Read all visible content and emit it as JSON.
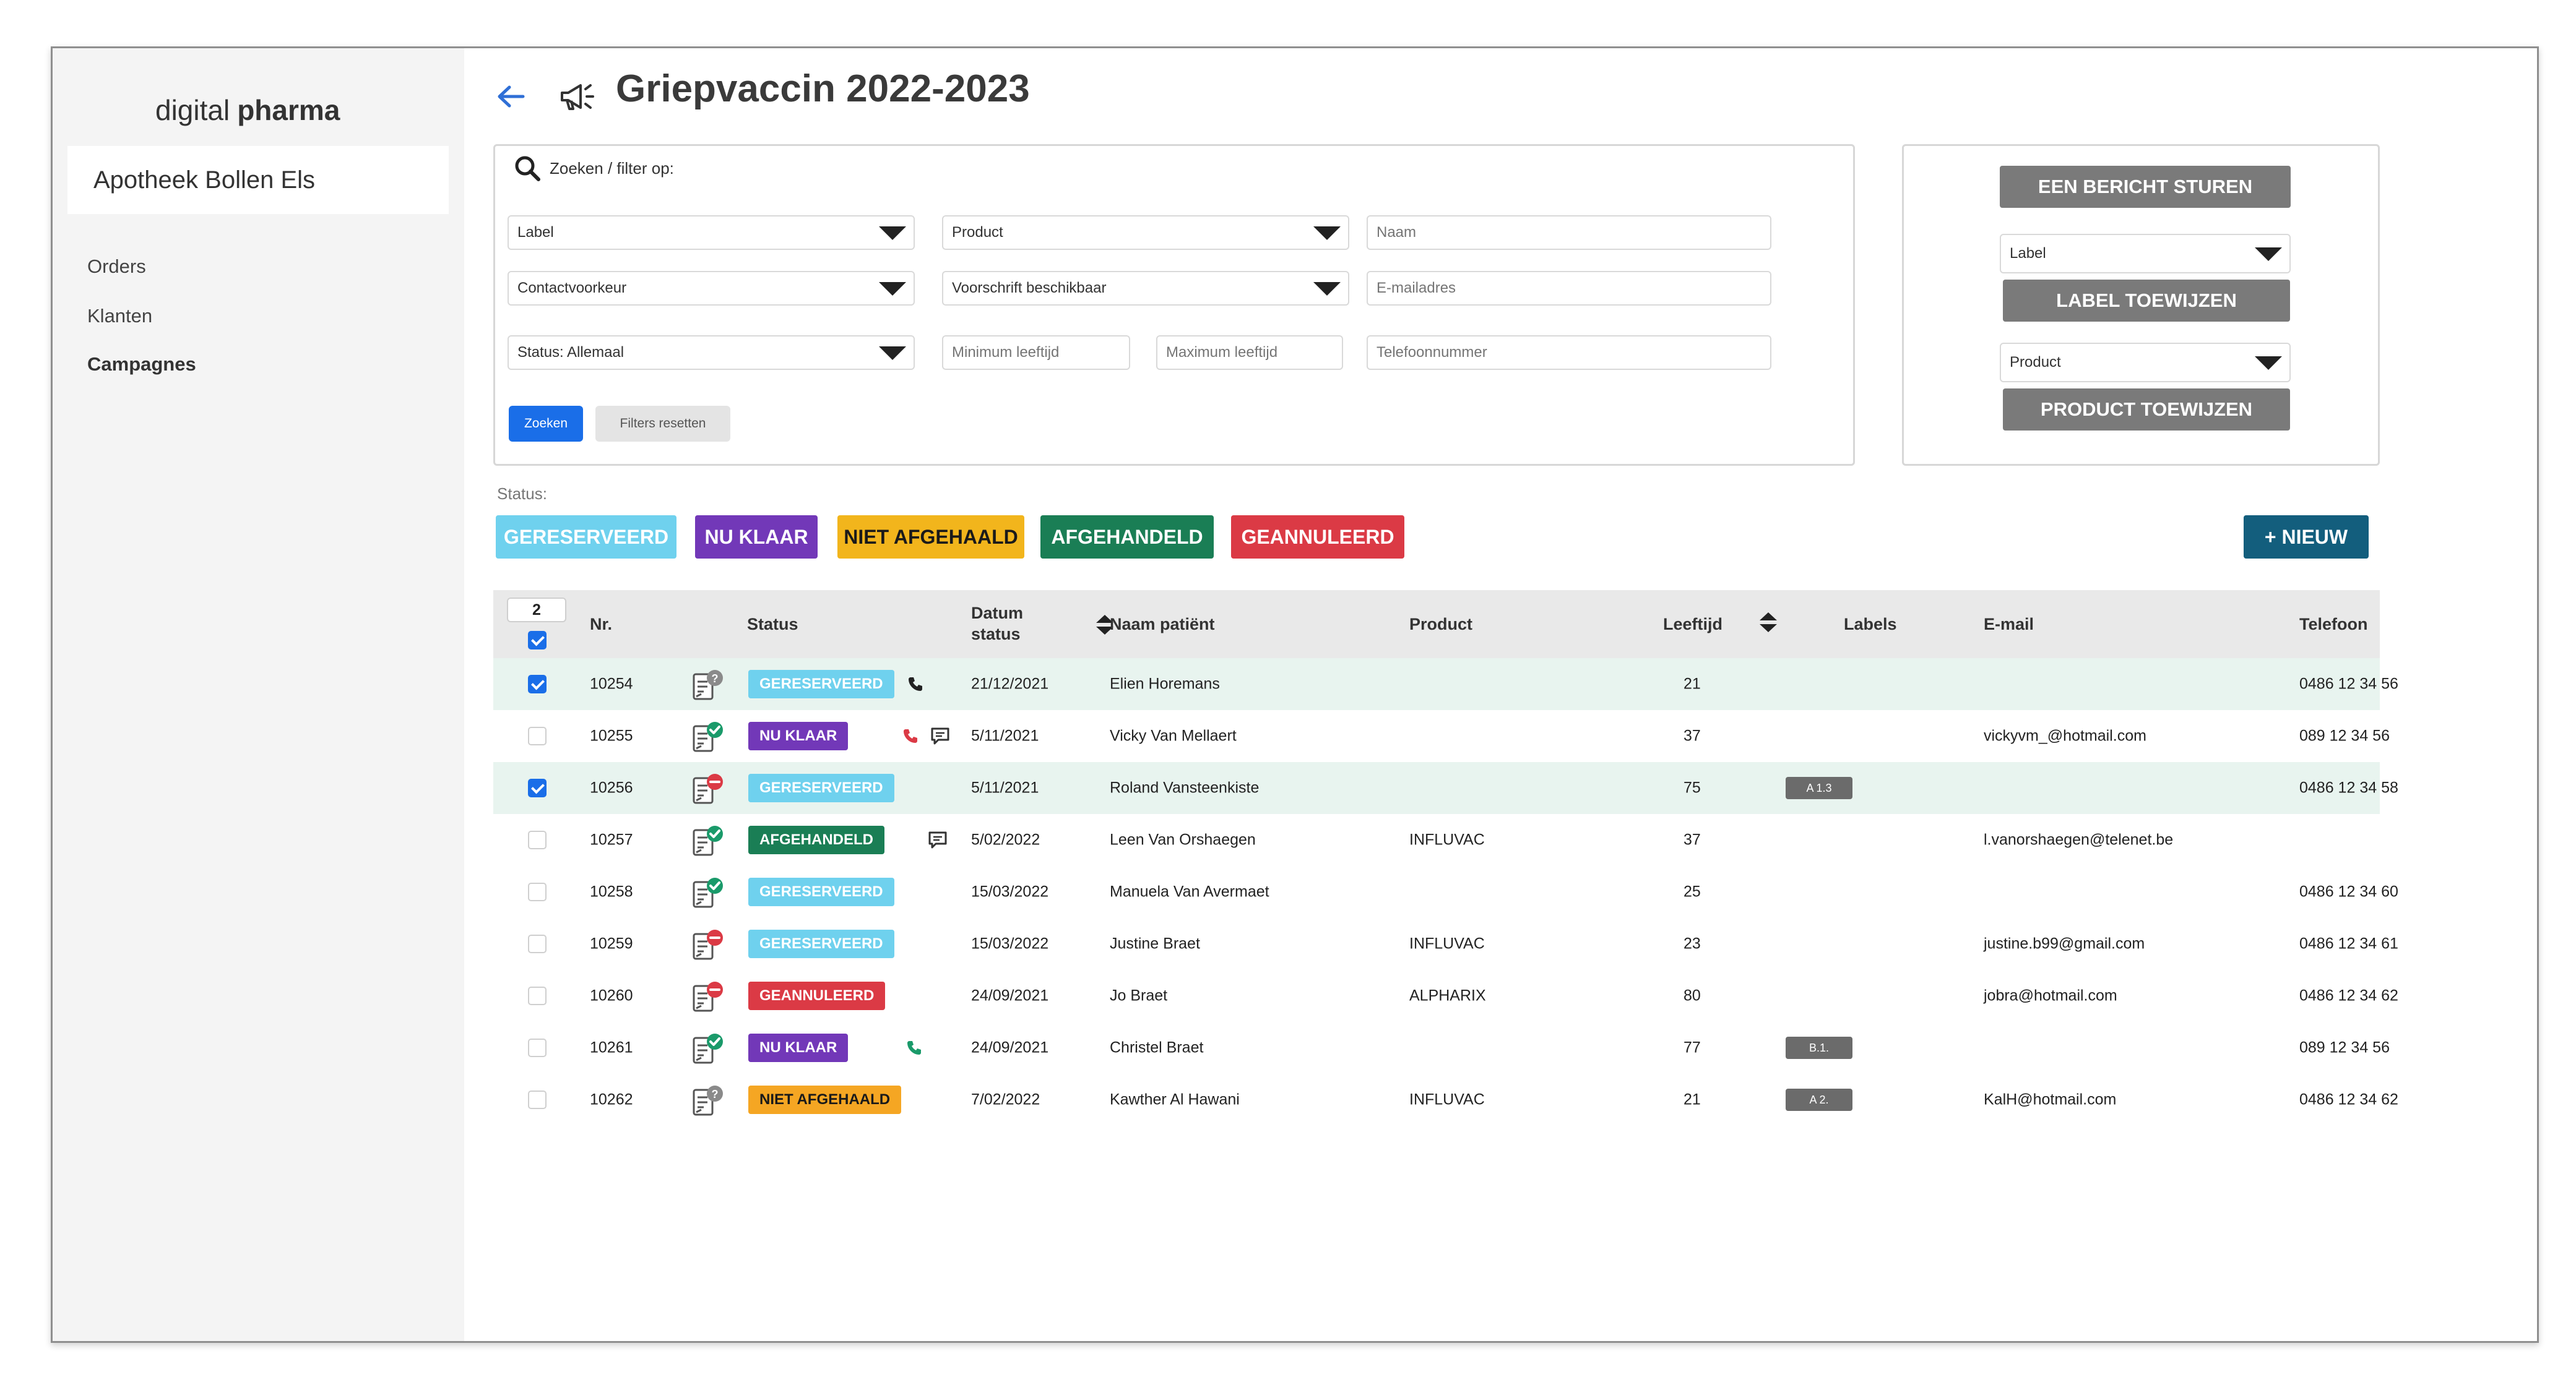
{
  "app": {
    "brand_light": "digital",
    "brand_bold": "pharma",
    "pharmacy": "Apotheek Bollen Els"
  },
  "nav": {
    "items": [
      {
        "label": "Orders"
      },
      {
        "label": "Klanten"
      },
      {
        "label": "Campagnes"
      }
    ],
    "active": "Campagnes"
  },
  "header": {
    "title": "Griepvaccin 2022-2023"
  },
  "filters": {
    "search_label": "Zoeken / filter op:",
    "label": "Label",
    "product": "Product",
    "name_placeholder": "Naam",
    "contact": "Contactvoorkeur",
    "prescription": "Voorschrift beschikbaar",
    "email_placeholder": "E-mailadres",
    "status": "Status: Allemaal",
    "min_age_placeholder": "Minimum leeftijd",
    "max_age_placeholder": "Maximum leeftijd",
    "phone_placeholder": "Telefoonnummer",
    "search_button": "Zoeken",
    "reset_button": "Filters resetten"
  },
  "actions": {
    "send_message": "EEN BERICHT STUREN",
    "label_select": "Label",
    "assign_label": "LABEL TOEWIJZEN",
    "product_select": "Product",
    "assign_product": "PRODUCT TOEWIJZEN"
  },
  "status_filter": {
    "caption": "Status:",
    "chips": [
      "GERESERVEERD",
      "NU KLAAR",
      "NIET AFGEHAALD",
      "AFGEHANDELD",
      "GEANNULEERD"
    ],
    "new_button": "+ NIEUW"
  },
  "colors": {
    "GERESERVEERD": "#6fd1ee",
    "NU KLAAR": "#7238b8",
    "NIET AFGEHAALD": "#f2b51c",
    "AFGEHANDELD": "#1a7e55",
    "GEANNULEERD": "#db3a45",
    "primary": "#1a6ee8",
    "new_button": "#135e7d"
  },
  "table": {
    "selected_count": "2",
    "columns": {
      "nr": "Nr.",
      "status": "Status",
      "date": "Datum status",
      "name": "Naam patiënt",
      "product": "Product",
      "age": "Leeftijd",
      "labels": "Labels",
      "email": "E-mail",
      "phone": "Telefoon"
    },
    "rows": [
      {
        "checked": true,
        "nr": "10254",
        "doc": "question",
        "status": "GERESERVEERD",
        "contact": "phone-black",
        "date": "21/12/2021",
        "name": "Elien Horemans",
        "product": "",
        "age": "21",
        "label": "",
        "email": "",
        "phone": "0486 12 34 56"
      },
      {
        "checked": false,
        "nr": "10255",
        "doc": "check",
        "status": "NU KLAAR",
        "contact": "phone-red-chat",
        "date": "5/11/2021",
        "name": "Vicky Van Mellaert",
        "product": "",
        "age": "37",
        "label": "",
        "email": "vickyvm_@hotmail.com",
        "phone": "089 12 34 56"
      },
      {
        "checked": true,
        "nr": "10256",
        "doc": "minus",
        "status": "GERESERVEERD",
        "contact": "",
        "date": "5/11/2021",
        "name": "Roland Vansteenkiste",
        "product": "",
        "age": "75",
        "label": "A 1.3",
        "email": "",
        "phone": "0486 12 34 58"
      },
      {
        "checked": false,
        "nr": "10257",
        "doc": "check",
        "status": "AFGEHANDELD",
        "contact": "chat",
        "date": "5/02/2022",
        "name": "Leen Van Orshaegen",
        "product": "INFLUVAC",
        "age": "37",
        "label": "",
        "email": "l.vanorshaegen@telenet.be",
        "phone": ""
      },
      {
        "checked": false,
        "nr": "10258",
        "doc": "check",
        "status": "GERESERVEERD",
        "contact": "",
        "date": "15/03/2022",
        "name": "Manuela Van Avermaet",
        "product": "",
        "age": "25",
        "label": "",
        "email": "",
        "phone": "0486 12 34 60"
      },
      {
        "checked": false,
        "nr": "10259",
        "doc": "minus",
        "status": "GERESERVEERD",
        "contact": "",
        "date": "15/03/2022",
        "name": "Justine Braet",
        "product": "INFLUVAC",
        "age": "23",
        "label": "",
        "email": "justine.b99@gmail.com",
        "phone": "0486 12 34 61"
      },
      {
        "checked": false,
        "nr": "10260",
        "doc": "minus",
        "status": "GEANNULEERD",
        "contact": "",
        "date": "24/09/2021",
        "name": "Jo Braet",
        "product": "ALPHARIX",
        "age": "80",
        "label": "",
        "email": "jobra@hotmail.com",
        "phone": "0486 12 34 62"
      },
      {
        "checked": false,
        "nr": "10261",
        "doc": "check",
        "status": "NU KLAAR",
        "contact": "phone-green",
        "date": "24/09/2021",
        "name": "Christel Braet",
        "product": "",
        "age": "77",
        "label": "B.1.",
        "email": "",
        "phone": "089 12 34 56"
      },
      {
        "checked": false,
        "nr": "10262",
        "doc": "question",
        "status": "NIET AFGEHAALD",
        "contact": "",
        "date": "7/02/2022",
        "name": "Kawther Al Hawani",
        "product": "INFLUVAC",
        "age": "21",
        "label": "A 2.",
        "email": "KalH@hotmail.com",
        "phone": "0486 12 34 62"
      }
    ]
  }
}
